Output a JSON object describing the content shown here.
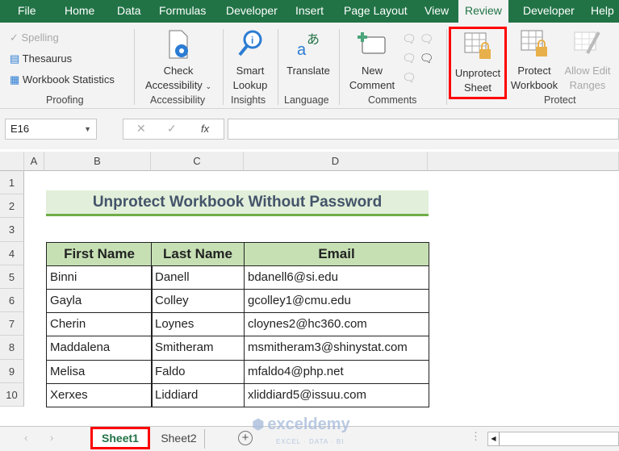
{
  "tabs": [
    "File",
    "Home",
    "Data",
    "Formulas",
    "Developer",
    "Insert",
    "Page Layout",
    "View",
    "Review",
    "Developer",
    "Help"
  ],
  "active_tab": "Review",
  "ribbon": {
    "proofing": {
      "spelling": "Spelling",
      "thesaurus": "Thesaurus",
      "stats": "Workbook Statistics",
      "label": "Proofing"
    },
    "accessibility": {
      "check1": "Check",
      "check2": "Accessibility",
      "label": "Accessibility"
    },
    "insights": {
      "l1": "Smart",
      "l2": "Lookup",
      "label": "Insights"
    },
    "language": {
      "l1": "Translate",
      "label": "Language"
    },
    "comments": {
      "l1": "New",
      "l2": "Comment",
      "label": "Comments"
    },
    "protect": {
      "unprotect1": "Unprotect",
      "unprotect2": "Sheet",
      "pw1": "Protect",
      "pw2": "Workbook",
      "ae1": "Allow Edit",
      "ae2": "Ranges",
      "label": "Protect"
    }
  },
  "formula_bar": {
    "name_box": "E16",
    "fx": "fx",
    "value": ""
  },
  "columns": [
    "A",
    "B",
    "C",
    "D"
  ],
  "rows": [
    "1",
    "2",
    "3",
    "4",
    "5",
    "6",
    "7",
    "8",
    "9",
    "10"
  ],
  "sheet": {
    "title": "Unprotect Workbook Without Password",
    "headers": [
      "First Name",
      "Last Name",
      "Email"
    ],
    "data": [
      [
        "Binni",
        "Danell",
        "bdanell6@si.edu"
      ],
      [
        "Gayla",
        "Colley",
        "gcolley1@cmu.edu"
      ],
      [
        "Cherin",
        "Loynes",
        "cloynes2@hc360.com"
      ],
      [
        "Maddalena",
        "Smitheram",
        "msmitheram3@shinystat.com"
      ],
      [
        "Melisa",
        "Faldo",
        "mfaldo4@php.net"
      ],
      [
        "Xerxes",
        "Liddiard",
        "xliddiard5@issuu.com"
      ]
    ]
  },
  "sheet_tabs": [
    "Sheet1",
    "Sheet2"
  ],
  "watermark": {
    "name": "exceldemy",
    "tag": "EXCEL · DATA · BI"
  },
  "colors": {
    "accent": "#217346",
    "highlight": "#ff0000",
    "header_fill": "#c6e0b4",
    "title_fill": "#e2efda"
  }
}
